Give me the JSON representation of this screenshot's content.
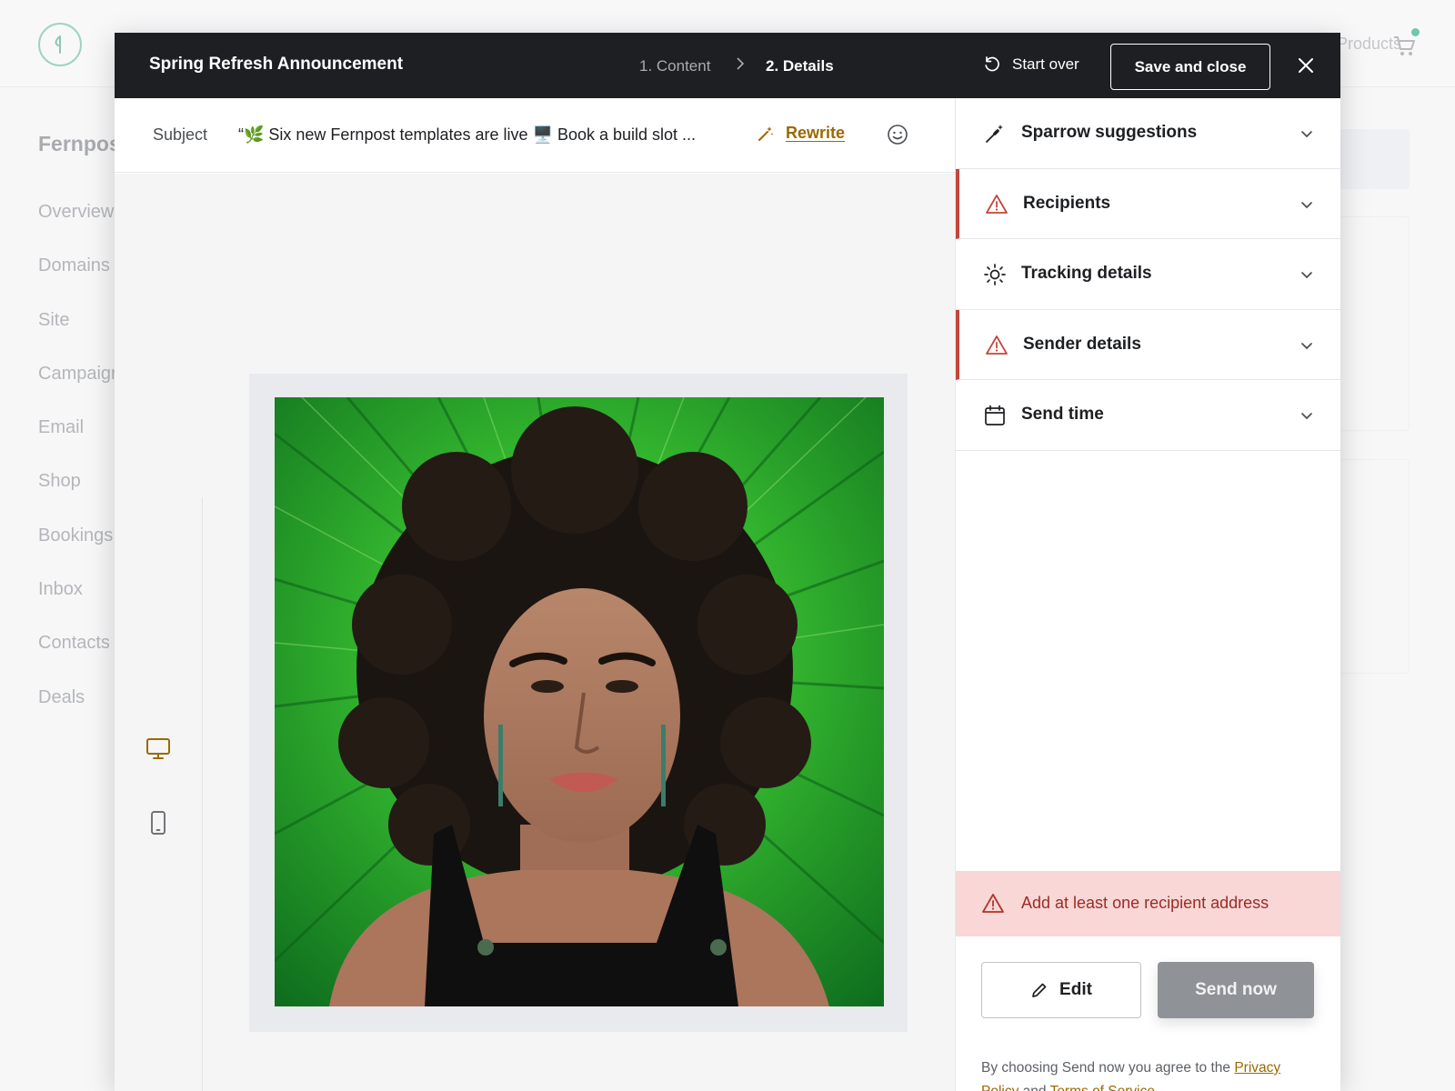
{
  "background": {
    "brand": "Fernpost",
    "nav": [
      "Overview",
      "Domains",
      "Site",
      "Campaigns",
      "Email",
      "Shop",
      "Bookings",
      "Inbox",
      "Contacts",
      "Deals"
    ],
    "header_right_text": "Products"
  },
  "modal": {
    "title": "Spring Refresh Announcement",
    "steps": [
      {
        "label": "1. Content",
        "active": false
      },
      {
        "label": "2. Details",
        "active": true
      }
    ],
    "start_over_label": "Start over",
    "save_close_label": "Save and close"
  },
  "subject": {
    "label": "Subject",
    "value": "“🌿 Six new Fernpost templates are live 🖥️ Book a build slot ...",
    "rewrite_label": "Rewrite"
  },
  "preview": {
    "modes": [
      "desktop",
      "mobile"
    ],
    "active_mode": "desktop",
    "image_alt": "Portrait of a woman with curly hair in front of green palm leaves"
  },
  "side_panel": {
    "sections": [
      {
        "label": "Sparrow suggestions",
        "icon": "magic-wand-icon",
        "error": false
      },
      {
        "label": "Recipients",
        "icon": "warning-icon",
        "error": true
      },
      {
        "label": "Tracking details",
        "icon": "sun-icon",
        "error": false
      },
      {
        "label": "Sender details",
        "icon": "warning-icon",
        "error": true
      },
      {
        "label": "Send time",
        "icon": "calendar-icon",
        "error": false
      }
    ],
    "alert_text": "Add at least one recipient address",
    "edit_label": "Edit",
    "send_now_label": "Send now",
    "legal": {
      "prefix": "By choosing Send now you agree to the ",
      "privacy_label": "Privacy Policy",
      "middle": " and ",
      "terms_label": "Terms of Service",
      "suffix": "."
    }
  },
  "colors": {
    "header_bg": "#1d1f22",
    "accent": "#9a6a00",
    "error": "#c5453b",
    "alert_bg": "#f8d7d6",
    "disabled_button": "#8f9296"
  }
}
